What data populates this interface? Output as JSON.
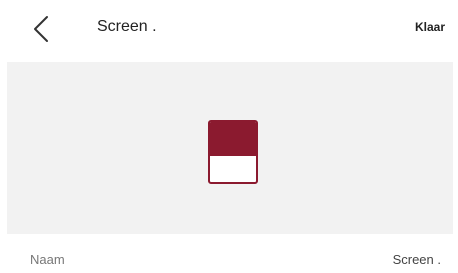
{
  "header": {
    "title": "Screen .",
    "done_label": "Klaar",
    "back_icon": "chevron-left-icon"
  },
  "preview": {
    "icon": "screen-icon",
    "icon_color": "#8b1a2f",
    "background_color": "#f2f2f2"
  },
  "name_row": {
    "label": "Naam",
    "value": "Screen ."
  }
}
